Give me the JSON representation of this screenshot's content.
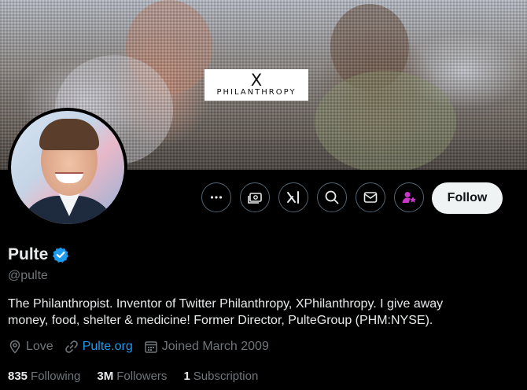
{
  "banner": {
    "logo_mark": "X",
    "logo_text": "PHILANTHROPY"
  },
  "profile": {
    "display_name": "Pulte",
    "handle": "@pulte",
    "verified": true,
    "verified_color": "#1d9bf0",
    "bio": "The Philanthropist. Inventor of Twitter Philanthropy, XPhilanthropy. I give away money, food, shelter & medicine! Former Director, PulteGroup (PHM:NYSE).",
    "location": "Love",
    "website": "Pulte.org",
    "joined": "Joined March 2009"
  },
  "actions": {
    "icons": [
      "more-icon",
      "money-icon",
      "grok-icon",
      "search-icon",
      "message-icon",
      "subscribe-icon"
    ],
    "follow_label": "Follow"
  },
  "stats": {
    "following_count": "835",
    "following_label": "Following",
    "followers_count": "3M",
    "followers_label": "Followers",
    "subscriptions_count": "1",
    "subscriptions_label": "Subscription"
  },
  "colors": {
    "background": "#000000",
    "text": "#e7e9ea",
    "muted": "#71767b",
    "accent": "#1d9bf0",
    "subscribe_accent": "#c936c9"
  }
}
